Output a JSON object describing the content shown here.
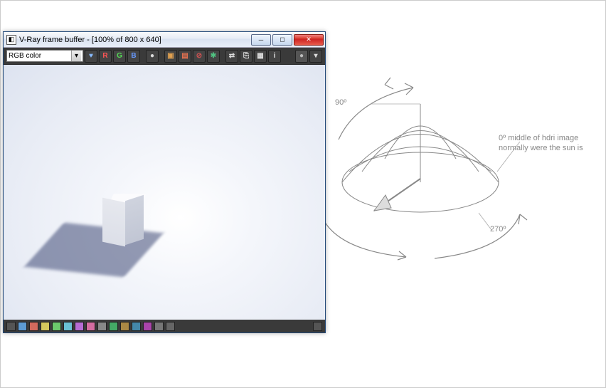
{
  "window": {
    "title": "V-Ray frame buffer - [100% of 800 x 640]"
  },
  "toolbar": {
    "channel_selector": "RGB color",
    "buttons": {
      "heart": "♥",
      "r": "R",
      "g": "G",
      "b": "B",
      "mono": "●",
      "save": "💾",
      "clear": "✕",
      "clock": "◐",
      "swap": "⇄",
      "link": "⎘",
      "grid": "▦",
      "info": "i"
    },
    "right_buttons": {
      "circle": "●",
      "more": "▾"
    }
  },
  "diagram": {
    "label_90": "90º",
    "label_270": "270º",
    "label_0": "0º middle of hdri image",
    "label_0b": "normally were the sun is"
  },
  "bottom_colors": [
    "#3a3a3a",
    "#5d9bd4",
    "#d46a5d",
    "#d4c85d",
    "#6cc96c",
    "#6ac1d4",
    "#b76cd4",
    "#d46ca0",
    "#888",
    "#4a6",
    "#a84",
    "#48a",
    "#a4a",
    "#888",
    "#666"
  ]
}
